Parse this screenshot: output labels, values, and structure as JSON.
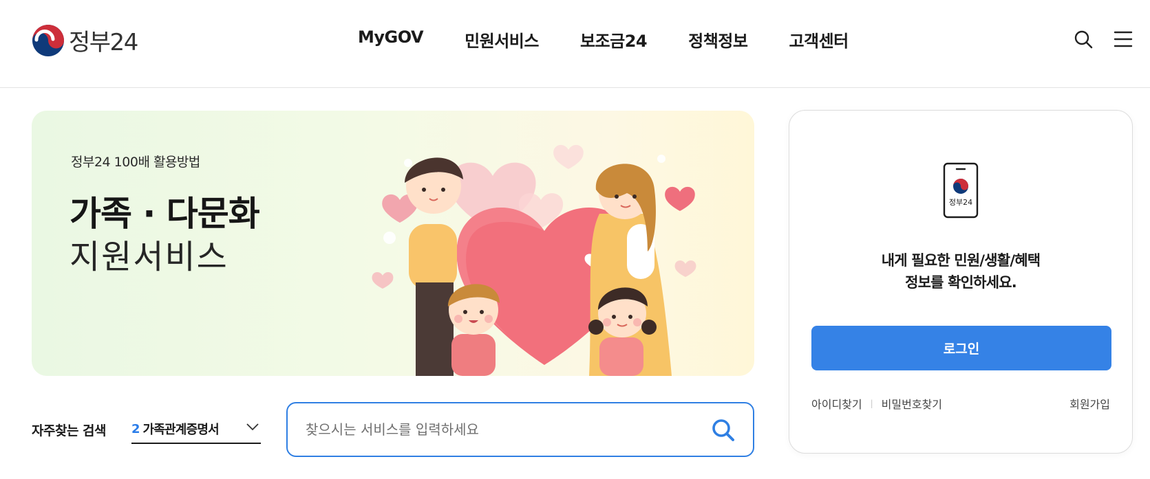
{
  "header": {
    "logo_text": "정부24",
    "nav": [
      "MyGOV",
      "민원서비스",
      "보조금24",
      "정책정보",
      "고객센터"
    ]
  },
  "banner": {
    "subtitle": "정부24 100배 활용방법",
    "title_line1": "가족 · 다문화",
    "title_line2": "지원서비스"
  },
  "search": {
    "freq_label": "자주찾는 검색",
    "freq_rank": "2",
    "freq_item": "가족관계증명서",
    "placeholder": "찾으시는 서비스를 입력하세요"
  },
  "login": {
    "phone_label": "정부24",
    "message_line1": "내게 필요한 민원/생활/혜택",
    "message_line2": "정보를 확인하세요.",
    "login_button": "로그인",
    "find_id": "아이디찾기",
    "find_password": "비밀번호찾기",
    "sign_up": "회원가입"
  },
  "colors": {
    "accent": "#3582e6",
    "search_border": "#2f7fe3",
    "logo_red": "#cd2e3a",
    "logo_blue": "#0f3a7a"
  },
  "icons": [
    "search-icon",
    "menu-icon",
    "chevron-down-icon",
    "phone-icon"
  ]
}
